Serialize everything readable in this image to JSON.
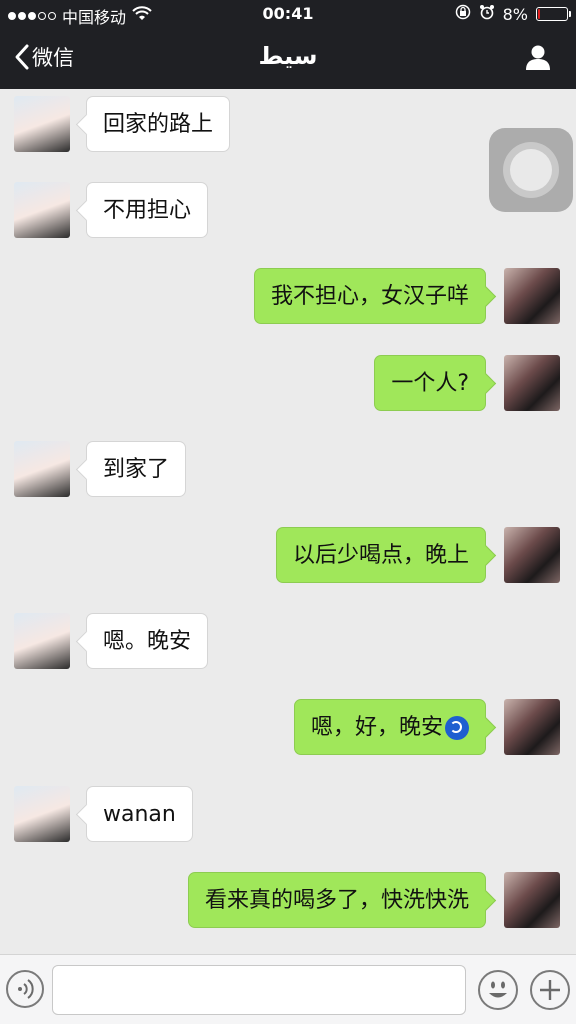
{
  "status_bar": {
    "carrier": "中国移动",
    "time": "00:41",
    "battery": "8%",
    "battery_level": 0.08,
    "signal_bars": 3
  },
  "nav": {
    "back_label": "微信",
    "title": "سيط"
  },
  "messages": [
    {
      "side": "in",
      "text": "回家的路上"
    },
    {
      "side": "in",
      "text": "不用担心"
    },
    {
      "side": "out",
      "text": "我不担心，女汉子咩"
    },
    {
      "side": "out",
      "text": "一个人?"
    },
    {
      "side": "in",
      "text": "到家了"
    },
    {
      "side": "out",
      "text": "以后少喝点，晚上"
    },
    {
      "side": "in",
      "text": "嗯。晚安"
    },
    {
      "side": "out",
      "text": "嗯，好，晚安",
      "emoji": "moon-emoji"
    },
    {
      "side": "in",
      "text": "wanan"
    },
    {
      "side": "out",
      "text": "看来真的喝多了，快洗快洗"
    }
  ],
  "input": {
    "placeholder": "",
    "icons": [
      "voice-icon",
      "emoji-icon",
      "plus-icon"
    ]
  },
  "colors": {
    "nav_background": "#1f2024",
    "chat_background": "#ebebeb",
    "outgoing_bubble": "#a0e75a",
    "incoming_bubble": "#ffffff"
  }
}
